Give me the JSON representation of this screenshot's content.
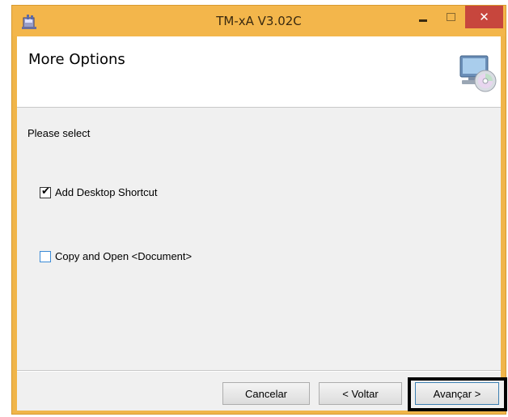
{
  "window": {
    "title": "TM-xA V3.02C",
    "controls": {
      "minimize": "minimize",
      "maximize": "maximize",
      "close": "✕"
    }
  },
  "header": {
    "title": "More Options",
    "icon": "computer-cd-icon"
  },
  "body": {
    "instruction": "Please select",
    "options": [
      {
        "label": "Add Desktop Shortcut",
        "checked": true
      },
      {
        "label": "Copy and Open <Document>",
        "checked": false
      }
    ]
  },
  "footer": {
    "cancel_label": "Cancelar",
    "back_label": "< Voltar",
    "next_label": "Avançar >"
  },
  "colors": {
    "titlebar": "#f3b64b",
    "close_button": "#c7463d",
    "checkbox_focus_border": "#3b8ad6"
  }
}
